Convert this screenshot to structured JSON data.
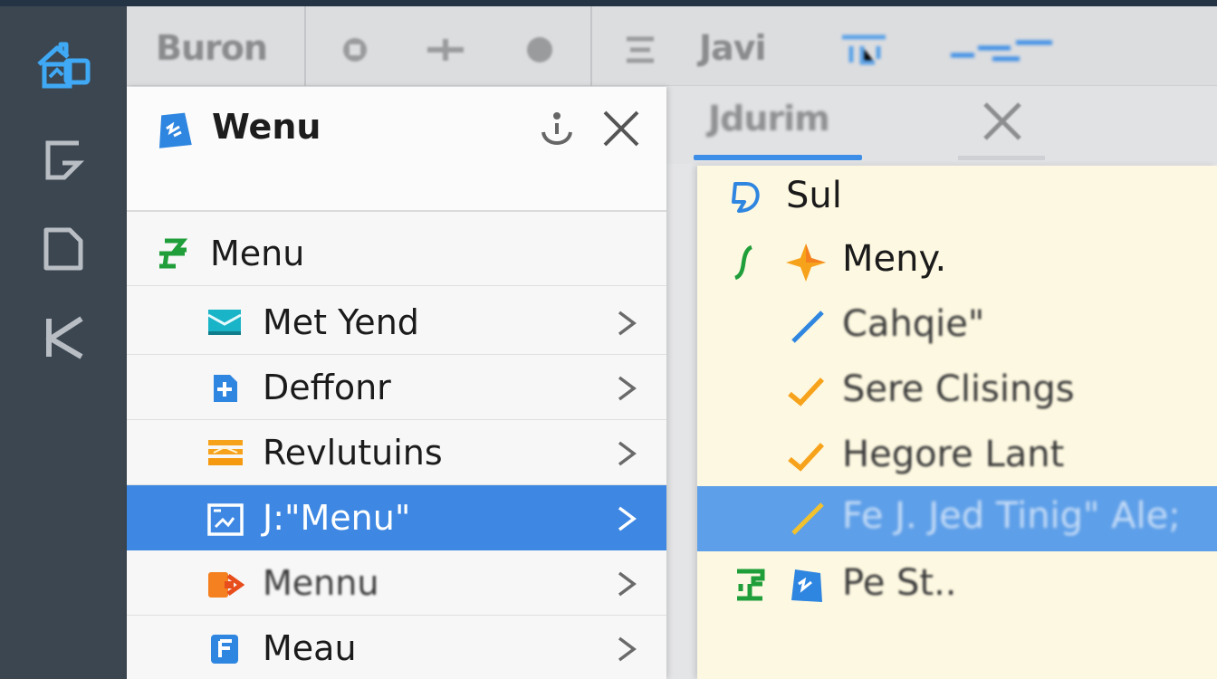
{
  "toolbar": {
    "text_left": "Buron",
    "text_mid": "Javi",
    "icons": [
      "gear-icon",
      "plus-icon",
      "record-icon",
      "align-icon",
      "blue-tool-icon",
      "blue-link-icon"
    ]
  },
  "activity_bar": {
    "icons": [
      "home-icon",
      "git-icon",
      "file-icon",
      "k-icon"
    ]
  },
  "tabs": [
    {
      "label": "Jdurim",
      "active": true
    }
  ],
  "left_panel": {
    "title": "Wenu",
    "items": [
      {
        "label": "Menu",
        "icon": "green-tool-icon",
        "chevron": false,
        "selected": false
      },
      {
        "label": "Met Yend",
        "icon": "cyan-folder-icon",
        "chevron": true,
        "selected": false
      },
      {
        "label": "Deffonr",
        "icon": "blue-plus-icon",
        "chevron": true,
        "selected": false
      },
      {
        "label": "Revlutuins",
        "icon": "orange-stack-icon",
        "chevron": true,
        "selected": false
      },
      {
        "label": "J:\"Menu\"",
        "icon": "image-frame-icon",
        "chevron": true,
        "selected": true
      },
      {
        "label": "Mennu",
        "icon": "orange-share-icon",
        "chevron": true,
        "selected": false
      },
      {
        "label": "Meau",
        "icon": "blue-f-icon",
        "chevron": true,
        "selected": false
      }
    ]
  },
  "right_panel": {
    "items": [
      {
        "label": "Sul",
        "icon": "blue-d-icon",
        "selected": false
      },
      {
        "label": "Meny.",
        "icon": "orange-star-icon",
        "selected": false
      },
      {
        "label": "Cahqie\"",
        "icon": "blue-slash-icon",
        "selected": false
      },
      {
        "label": "Sere Clisings",
        "icon": "orange-check-icon",
        "selected": false
      },
      {
        "label": "Hegore Lant",
        "icon": "orange-check-icon",
        "selected": false
      },
      {
        "label": "Fe J. Jed Tinig\" Ale;",
        "icon": "yellow-slash-icon",
        "selected": true
      },
      {
        "label": "Pe St..",
        "icon": "blue-badge-icon",
        "selected": false
      }
    ]
  },
  "colors": {
    "accent": "#3e88e3",
    "activity_bg": "#3b4651",
    "right_panel_bg": "#fdf8e1",
    "orange": "#f7a21b",
    "green": "#1f9e3a"
  }
}
